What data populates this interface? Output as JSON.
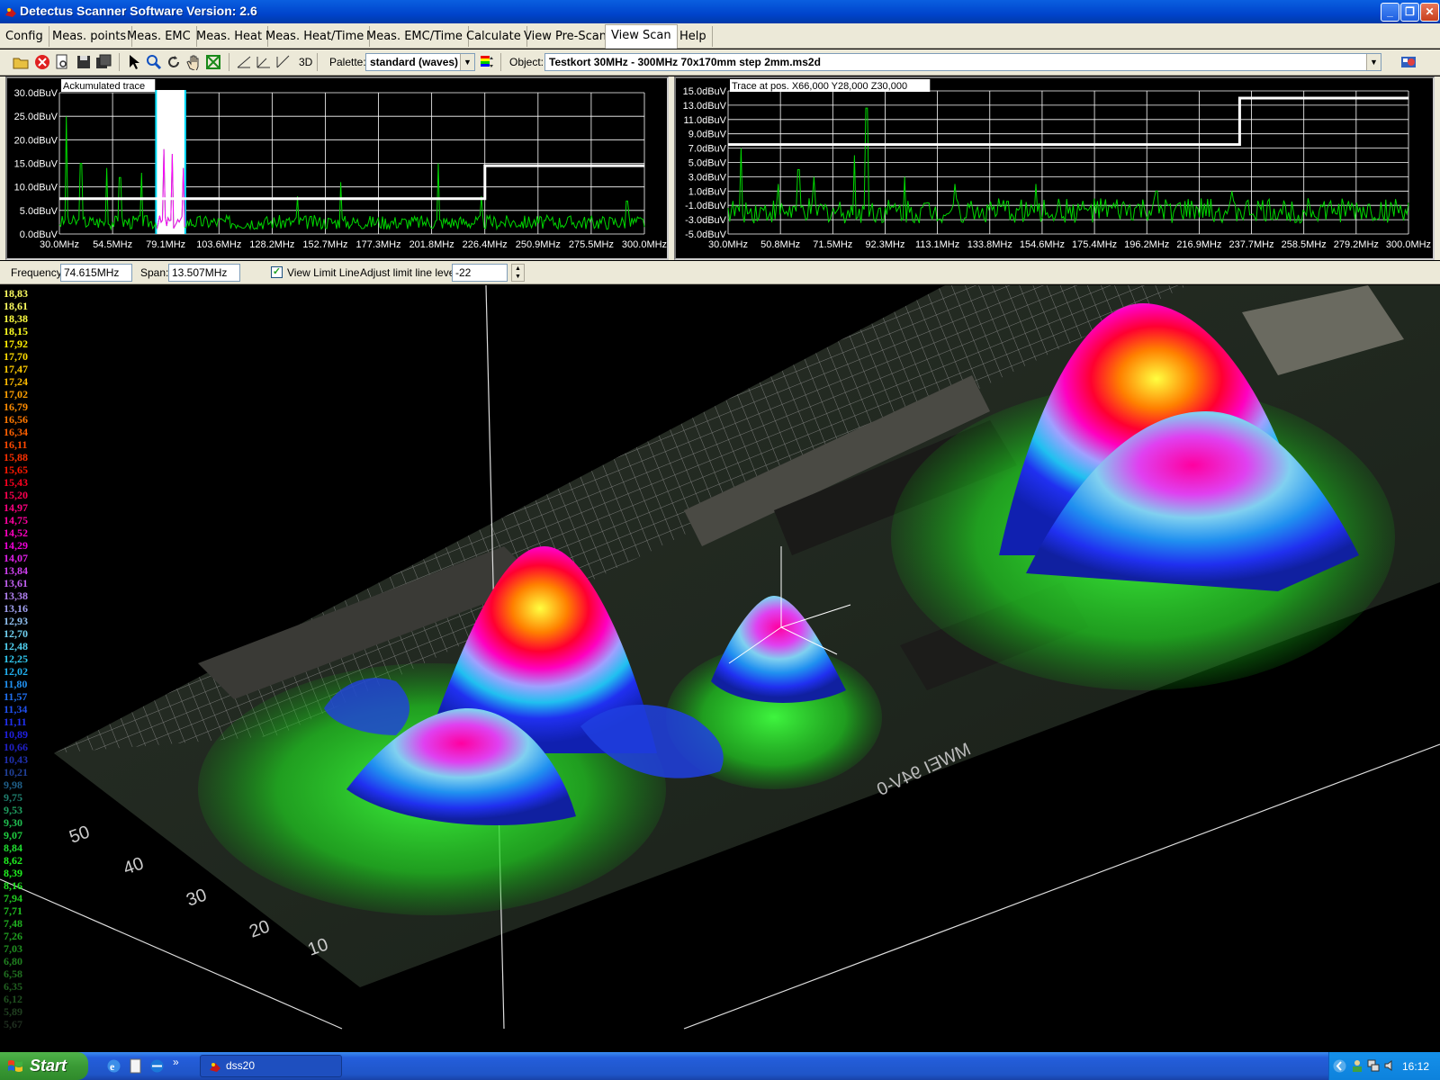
{
  "window": {
    "title": "Detectus Scanner Software Version: 2.6"
  },
  "menu": [
    {
      "label": "Config",
      "active": false
    },
    {
      "label": "Meas. points",
      "active": false
    },
    {
      "label": "Meas. EMC",
      "active": false
    },
    {
      "label": "Meas. Heat",
      "active": false
    },
    {
      "label": "Meas. Heat/Time",
      "active": false
    },
    {
      "label": "Meas. EMC/Time",
      "active": false
    },
    {
      "label": "Calculate",
      "active": false
    },
    {
      "label": "View Pre-Scan",
      "active": false
    },
    {
      "label": "View Scan",
      "active": true
    },
    {
      "label": "Help",
      "active": false
    }
  ],
  "toolbar": {
    "view3d_label": "3D",
    "palette_label": "Palette:",
    "palette_value": "standard (waves)",
    "object_label": "Object:",
    "object_value": "Testkort 30MHz - 300MHz 70x170mm step 2mm.ms2d"
  },
  "chart_data": [
    {
      "type": "line",
      "title": "Ackumulated trace",
      "x_ticks": [
        "30.0MHz",
        "54.5MHz",
        "79.1MHz",
        "103.6MHz",
        "128.2MHz",
        "152.7MHz",
        "177.3MHz",
        "201.8MHz",
        "226.4MHz",
        "250.9MHz",
        "275.5MHz",
        "300.0MHz"
      ],
      "y_ticks": [
        "30.0dBuV",
        "25.0dBuV",
        "20.0dBuV",
        "15.0dBuV",
        "10.0dBuV",
        "5.0dBuV",
        "0.0dBuV"
      ],
      "xlim": [
        30,
        300
      ],
      "ylim": [
        0,
        30
      ],
      "grid": true,
      "limit_line": [
        [
          30,
          7.5
        ],
        [
          226.4,
          7.5
        ],
        [
          226.4,
          14.5
        ],
        [
          300,
          14.5
        ]
      ],
      "highlight_band": [
        74.6,
        88.1
      ],
      "peaks": [
        [
          33,
          25
        ],
        [
          40,
          15
        ],
        [
          52,
          14
        ],
        [
          58,
          12
        ],
        [
          68,
          13
        ],
        [
          78,
          18
        ],
        [
          82,
          17
        ],
        [
          87,
          14
        ],
        [
          140,
          8
        ],
        [
          160,
          11
        ],
        [
          205,
          15
        ],
        [
          225,
          8
        ],
        [
          292,
          7
        ]
      ],
      "noise_floor": [
        1,
        4
      ],
      "series_color": "#00d800"
    },
    {
      "type": "line",
      "title": "Trace at pos. X66,000 Y28,000 Z30,000",
      "x_ticks": [
        "30.0MHz",
        "50.8MHz",
        "71.5MHz",
        "92.3MHz",
        "113.1MHz",
        "133.8MHz",
        "154.6MHz",
        "175.4MHz",
        "196.2MHz",
        "216.9MHz",
        "237.7MHz",
        "258.5MHz",
        "279.2MHz",
        "300.0MHz"
      ],
      "y_ticks": [
        "15.0dBuV",
        "13.0dBuV",
        "11.0dBuV",
        "9.0dBuV",
        "7.0dBuV",
        "5.0dBuV",
        "3.0dBuV",
        "1.0dBuV",
        "-1.0dBuV",
        "-3.0dBuV",
        "-5.0dBuV"
      ],
      "xlim": [
        30,
        300
      ],
      "ylim": [
        -5,
        15
      ],
      "grid": true,
      "limit_line": [
        [
          30,
          7.5
        ],
        [
          233,
          7.5
        ],
        [
          233,
          14
        ],
        [
          300,
          14
        ]
      ],
      "peaks": [
        [
          35,
          7
        ],
        [
          50,
          2
        ],
        [
          58,
          4
        ],
        [
          64,
          3
        ],
        [
          80,
          6
        ],
        [
          85,
          12.6
        ],
        [
          100,
          3
        ],
        [
          120,
          2
        ],
        [
          152,
          2
        ],
        [
          200,
          1
        ],
        [
          230,
          1
        ],
        [
          260,
          0
        ]
      ],
      "noise_floor": [
        -3.5,
        0
      ],
      "series_color": "#00d800"
    }
  ],
  "controls": {
    "frequency_label": "Frequency:",
    "frequency_value": "74.615MHz",
    "span_label": "Span:",
    "span_value": "13.507MHz",
    "view_limit_label": "View Limit Line",
    "view_limit_checked": true,
    "adjust_label": "Adjust limit line level:",
    "adjust_value": "-22"
  },
  "scale": [
    {
      "v": "18,83",
      "c": "#ffff60"
    },
    {
      "v": "18,61",
      "c": "#ffff60"
    },
    {
      "v": "18,38",
      "c": "#ffff40"
    },
    {
      "v": "18,15",
      "c": "#ffff20"
    },
    {
      "v": "17,92",
      "c": "#ffee00"
    },
    {
      "v": "17,70",
      "c": "#ffdd00"
    },
    {
      "v": "17,47",
      "c": "#ffcc00"
    },
    {
      "v": "17,24",
      "c": "#ffbb00"
    },
    {
      "v": "17,02",
      "c": "#ffa000"
    },
    {
      "v": "16,79",
      "c": "#ff8c00"
    },
    {
      "v": "16,56",
      "c": "#ff7800"
    },
    {
      "v": "16,34",
      "c": "#ff6000"
    },
    {
      "v": "16,11",
      "c": "#ff4800"
    },
    {
      "v": "15,88",
      "c": "#ff3000"
    },
    {
      "v": "15,65",
      "c": "#ff1800"
    },
    {
      "v": "15,43",
      "c": "#ff0020"
    },
    {
      "v": "15,20",
      "c": "#ff0050"
    },
    {
      "v": "14,97",
      "c": "#ff0080"
    },
    {
      "v": "14,75",
      "c": "#ff00a0"
    },
    {
      "v": "14,52",
      "c": "#ff00c0"
    },
    {
      "v": "14,29",
      "c": "#f000d8"
    },
    {
      "v": "14,07",
      "c": "#e020e8"
    },
    {
      "v": "13,84",
      "c": "#d040f0"
    },
    {
      "v": "13,61",
      "c": "#c060f0"
    },
    {
      "v": "13,38",
      "c": "#b080f0"
    },
    {
      "v": "13,16",
      "c": "#a0a0f0"
    },
    {
      "v": "12,93",
      "c": "#90c0f0"
    },
    {
      "v": "12,70",
      "c": "#70d0f0"
    },
    {
      "v": "12,48",
      "c": "#50d0f0"
    },
    {
      "v": "12,25",
      "c": "#30c8f0"
    },
    {
      "v": "12,02",
      "c": "#20b0f0"
    },
    {
      "v": "11,80",
      "c": "#2090f0"
    },
    {
      "v": "11,57",
      "c": "#2070f0"
    },
    {
      "v": "11,34",
      "c": "#2050f0"
    },
    {
      "v": "11,11",
      "c": "#2030f0"
    },
    {
      "v": "10,89",
      "c": "#2020e0"
    },
    {
      "v": "10,66",
      "c": "#2020c8"
    },
    {
      "v": "10,43",
      "c": "#2030b0"
    },
    {
      "v": "10,21",
      "c": "#204098"
    },
    {
      "v": "9,98",
      "c": "#20608a"
    },
    {
      "v": "9,75",
      "c": "#208070"
    },
    {
      "v": "9,53",
      "c": "#20a060"
    },
    {
      "v": "9,30",
      "c": "#20c050"
    },
    {
      "v": "9,07",
      "c": "#20d040"
    },
    {
      "v": "8,84",
      "c": "#20e030"
    },
    {
      "v": "8,62",
      "c": "#20f020"
    },
    {
      "v": "8,39",
      "c": "#20f020"
    },
    {
      "v": "8,16",
      "c": "#20e020"
    },
    {
      "v": "7,94",
      "c": "#20d020"
    },
    {
      "v": "7,71",
      "c": "#20c020"
    },
    {
      "v": "7,48",
      "c": "#20b020"
    },
    {
      "v": "7,26",
      "c": "#20a020"
    },
    {
      "v": "7,03",
      "c": "#209020"
    },
    {
      "v": "6,80",
      "c": "#208020"
    },
    {
      "v": "6,58",
      "c": "#207020"
    },
    {
      "v": "6,35",
      "c": "#206020"
    },
    {
      "v": "6,12",
      "c": "#205020"
    },
    {
      "v": "5,89",
      "c": "#204020"
    },
    {
      "v": "5,67",
      "c": "#203020"
    }
  ],
  "board_ruler": [
    "50",
    "40",
    "30",
    "20",
    "10"
  ],
  "board_marking": "MWEI 94V-0",
  "taskbar": {
    "start_label": "Start",
    "task_label": "dss20",
    "clock": "16:12"
  },
  "colors": {
    "title_bar": "#0044cc",
    "face": "#ece9d8",
    "trace": "#00d800",
    "limit_line": "#ffffff",
    "highlight": "#00e0ff"
  }
}
